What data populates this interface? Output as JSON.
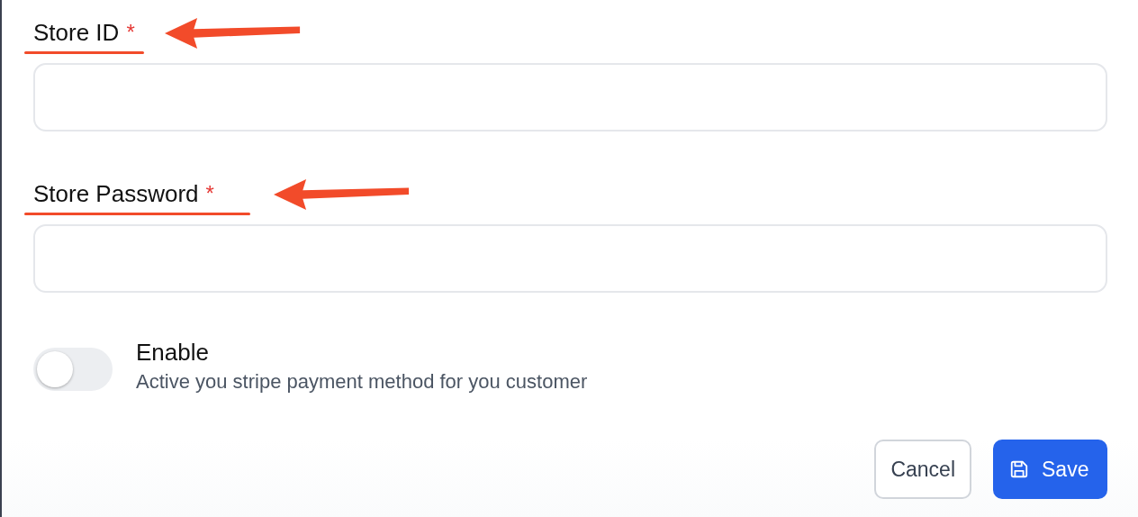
{
  "fields": [
    {
      "label": "Store ID",
      "required_mark": "*",
      "highlighted": true
    },
    {
      "label": "Store Password",
      "required_mark": "*",
      "highlighted": true
    }
  ],
  "toggle": {
    "title": "Enable",
    "description": "Active you stripe payment method for you customer",
    "on": false
  },
  "buttons": [
    {
      "label": "Cancel",
      "kind": "secondary"
    },
    {
      "label": "Save",
      "kind": "primary"
    }
  ]
}
